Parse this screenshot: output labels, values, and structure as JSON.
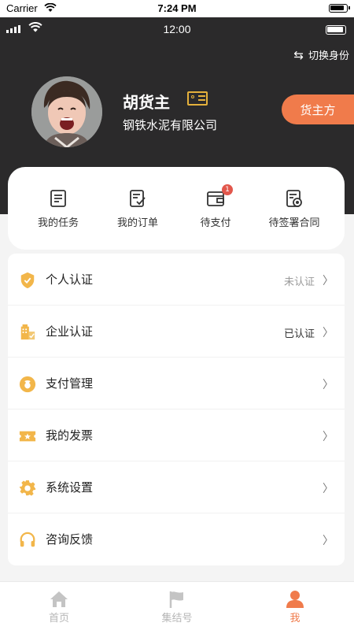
{
  "device_status": {
    "carrier": "Carrier",
    "time": "7:24 PM"
  },
  "app_status": {
    "time": "12:00"
  },
  "header": {
    "switch_identity": "切换身份",
    "user_name": "胡货主",
    "company": "钢铁水泥有限公司",
    "role_tag": "货主方"
  },
  "quick_actions": [
    {
      "label": "我的任务",
      "icon": "task-list-icon"
    },
    {
      "label": "我的订单",
      "icon": "order-icon"
    },
    {
      "label": "待支付",
      "icon": "wallet-icon",
      "badge": "1"
    },
    {
      "label": "待签署合同",
      "icon": "contract-icon"
    }
  ],
  "menu": [
    {
      "label": "个人认证",
      "status": "未认证",
      "icon": "shield-check-icon"
    },
    {
      "label": "企业认证",
      "status": "已认证",
      "icon": "building-icon"
    },
    {
      "label": "支付管理",
      "status": "",
      "icon": "money-bag-icon"
    },
    {
      "label": "我的发票",
      "status": "",
      "icon": "invoice-ticket-icon"
    },
    {
      "label": "系统设置",
      "status": "",
      "icon": "gear-icon"
    },
    {
      "label": "咨询反馈",
      "status": "",
      "icon": "headset-icon"
    }
  ],
  "tabbar": [
    {
      "label": "首页",
      "icon": "home-icon",
      "active": false
    },
    {
      "label": "集结号",
      "icon": "flag-icon",
      "active": false
    },
    {
      "label": "我",
      "icon": "person-icon",
      "active": true
    }
  ],
  "colors": {
    "accent": "#f07b4b",
    "gold": "#e5b13c",
    "header_bg": "#2b2a2b"
  }
}
